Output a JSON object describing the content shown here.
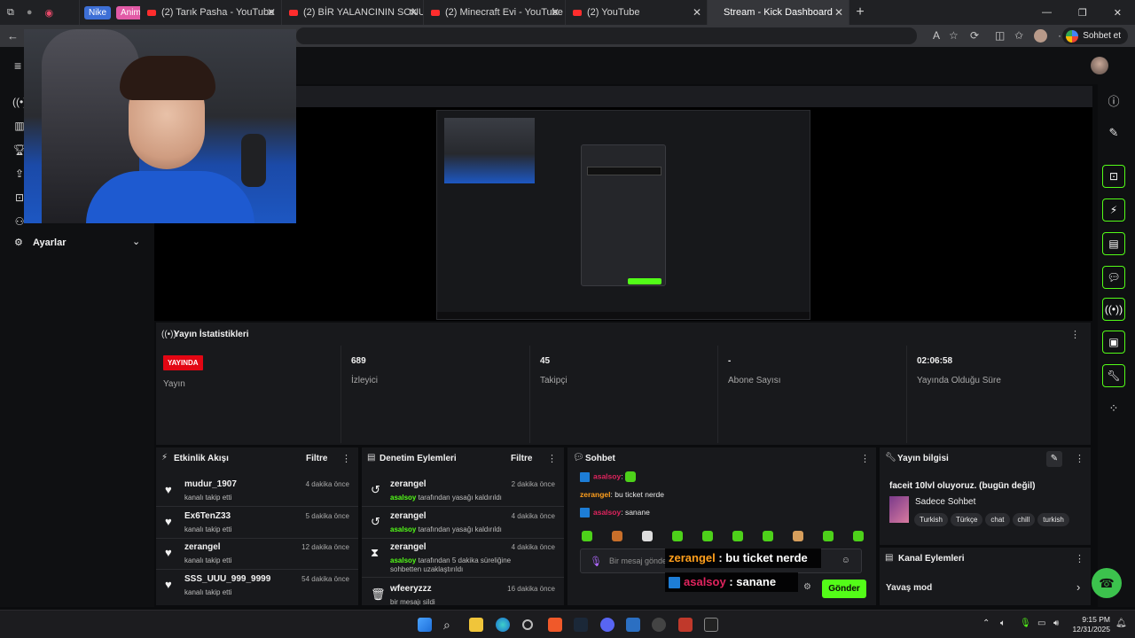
{
  "browser": {
    "tabs": [
      {
        "label": "Nike"
      },
      {
        "label": "Anime"
      },
      {
        "label": "(2) Tarık Pasha - YouTube"
      },
      {
        "label": "(2) BİR YALANCININ SONU? - CHA"
      },
      {
        "label": "(2) Minecraft Evi - YouTube"
      },
      {
        "label": "(2) YouTube"
      },
      {
        "label": "Stream - Kick Dashboard"
      }
    ],
    "share_label": "Sohbet et"
  },
  "sidebar": {
    "settings_label": "Ayarlar"
  },
  "stats": {
    "title": "Yayın İstatistikleri",
    "live_badge": "YAYINDA",
    "items": [
      {
        "value": "",
        "label": "Yayın"
      },
      {
        "value": "689",
        "label": "İzleyici"
      },
      {
        "value": "45",
        "label": "Takipçi"
      },
      {
        "value": "-",
        "label": "Abone Sayısı"
      },
      {
        "value": "02:06:58",
        "label": "Yayında Olduğu Süre"
      }
    ]
  },
  "activity": {
    "title": "Etkinlik Akışı",
    "filter": "Filtre",
    "rows": [
      {
        "name": "mudur_1907",
        "sub": "kanalı takip etti",
        "time": "4 dakika önce"
      },
      {
        "name": "Ex6TenZ33",
        "sub": "kanalı takip etti",
        "time": "5 dakika önce"
      },
      {
        "name": "zerangel",
        "sub": "kanalı takip etti",
        "time": "12 dakika önce"
      },
      {
        "name": "SSS_UUU_999_9999",
        "sub": "kanalı takip etti",
        "time": "54 dakika önce"
      }
    ]
  },
  "moderation": {
    "title": "Denetim Eylemleri",
    "filter": "Filtre",
    "rows": [
      {
        "name": "zerangel",
        "actor": "asalsoy",
        "sub": "tarafından yasağı kaldırıldı",
        "time": "2 dakika önce"
      },
      {
        "name": "zerangel",
        "actor": "asalsoy",
        "sub": "tarafından yasağı kaldırıldı",
        "time": "4 dakika önce"
      },
      {
        "name": "zerangel",
        "actor": "asalsoy",
        "sub": "tarafından 5 dakika süreliğine sohbetten uzaklaştırıldı",
        "time": "4 dakika önce"
      },
      {
        "name": "wfeeryzzz",
        "actor": "",
        "sub": "bir mesajı sildi",
        "time": "16 dakika önce"
      }
    ]
  },
  "chat": {
    "title": "Sohbet",
    "messages": [
      {
        "user": "asalsoy",
        "text": ""
      },
      {
        "user": "zerangel",
        "text": "bu ticket nerde"
      },
      {
        "user": "asalsoy",
        "text": "sanane"
      }
    ],
    "input_placeholder": "Bir mesaj gönder",
    "send_label": "Gönder",
    "overlay_lines": [
      {
        "user": "zerangel",
        "text": " : bu ticket nerde"
      },
      {
        "user": "asalsoy",
        "text": " : sanane"
      }
    ]
  },
  "stream_info": {
    "title": "Yayın bilgisi",
    "stream_title": "faceit 10lvl oluyoruz. (bugün değil)",
    "category": "Sadece Sohbet",
    "tags": [
      "Turkish",
      "Türkçe",
      "chat",
      "chill",
      "turkish"
    ]
  },
  "channel_actions": {
    "title": "Kanal Eylemleri",
    "first_action": "Yavaş mod"
  },
  "taskbar": {
    "time": "9:15 PM",
    "date": "12/31/2025"
  },
  "colors": {
    "kick_green": "#53fc18",
    "live_red": "#e30613",
    "chat_user_zerangel": "#ff9f1c",
    "chat_user_asalsoy": "#e0245e"
  }
}
